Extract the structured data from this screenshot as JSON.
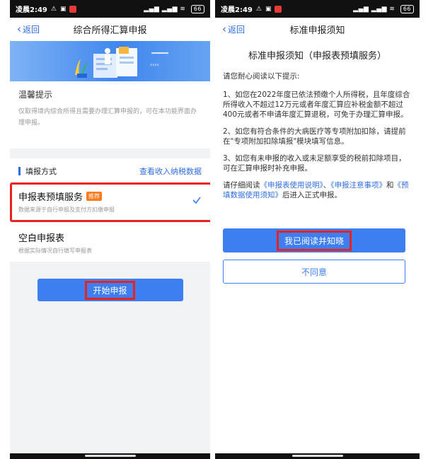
{
  "left": {
    "status": {
      "time": "凌晨2:49",
      "battery": "66"
    },
    "nav": {
      "back": "返回",
      "title": "综合所得汇算申报"
    },
    "tips": {
      "title": "温馨提示",
      "text": "仅取得境内综合所得且需要办理汇算申报的，可在本功能界面办理申报。"
    },
    "methods": {
      "title": "填报方式",
      "link": "查看收入纳税数据",
      "options": [
        {
          "title": "申报表预填服务",
          "badge": "推荐",
          "desc": "数据来源于自行申报及支付方扣缴申报",
          "selected": true
        },
        {
          "title": "空白申报表",
          "desc": "根据实际情况自行填写申报表"
        }
      ]
    },
    "start_button": "开始申报"
  },
  "right": {
    "status": {
      "time": "凌晨2:49",
      "battery": "66"
    },
    "nav": {
      "back": "返回",
      "title": "标准申报须知"
    },
    "notice_title": "标准申报须知（申报表预填服务）",
    "intro": "请您耐心阅读以下提示:",
    "items": [
      "1、如您在2022年度已依法预缴个人所得税，且年度综合所得收入不超过12万元或者年度汇算应补税金额不超过400元或者不申请年度汇算退税，可免于办理汇算申报。",
      "2、如您有符合条件的大病医疗等专项附加扣除，请提前在\"专项附加扣除填报\"模块填写信息。",
      "3、如您有未申报的收入或未足额享受的税前扣除项目，可在汇算申报时补充申报。"
    ],
    "read_prompt": {
      "prefix": "请仔细阅读",
      "link1": "《申报表使用说明》",
      "sep1": "、",
      "link2": "《申报注意事项》",
      "and": "和",
      "link3": "《预填数据使用须知》",
      "suffix": "后进入正式申报。"
    },
    "agree_button": "我已阅读并知晓",
    "disagree_button": "不同意"
  },
  "colors": {
    "accent": "#3d7ff0",
    "highlight": "#e8231f",
    "badge": "#ff7a1a"
  }
}
